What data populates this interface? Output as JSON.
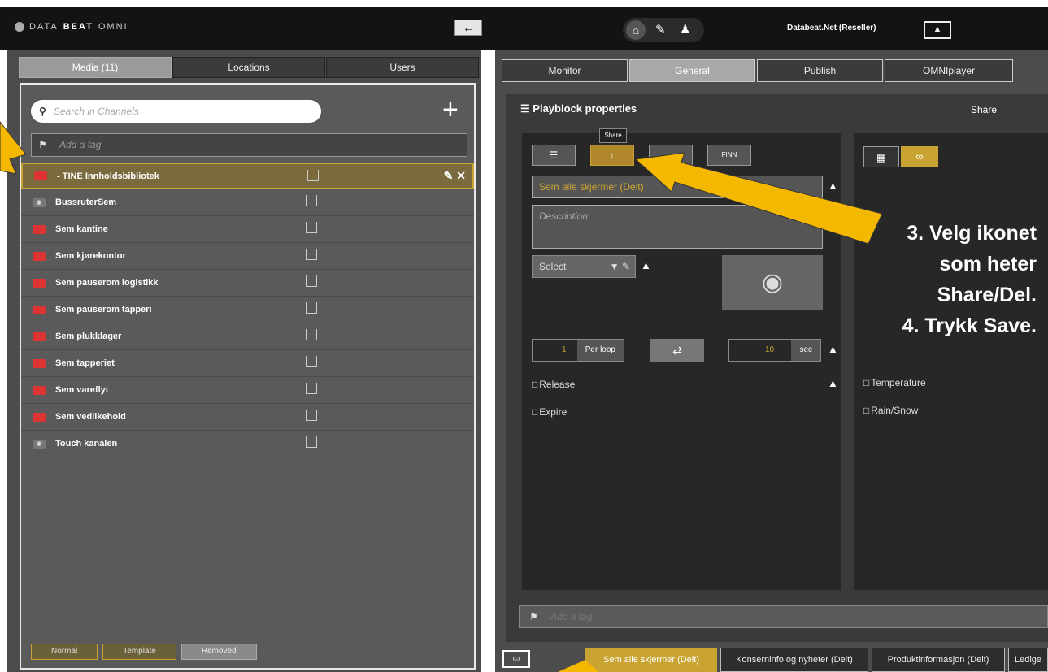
{
  "topbar": {
    "brand_pre": "DATA",
    "brand_bold": "BEAT",
    "brand_post": "OMNI",
    "back_icon": "←",
    "home_icon": "⌂",
    "edit_icon": "✎",
    "user_icon": "♟",
    "reseller": "Databeat.Net (Reseller)",
    "image_icon": "▲"
  },
  "left": {
    "tabs": [
      "Media (11)",
      "Locations",
      "Users"
    ],
    "search_placeholder": "Search in Channels",
    "plus": "+",
    "tag_placeholder": "Add a tag",
    "channels": [
      {
        "name": "- TINE Innholdsbibliotek",
        "icon": "TINE",
        "selected": true
      },
      {
        "name": "BussruterSem",
        "icon": "cam"
      },
      {
        "name": "Sem kantine",
        "icon": "TINE"
      },
      {
        "name": "Sem kjørekontor",
        "icon": "TINE"
      },
      {
        "name": "Sem pauserom logistikk",
        "icon": "TINE"
      },
      {
        "name": "Sem pauserom tapperi",
        "icon": "TINE"
      },
      {
        "name": "Sem plukklager",
        "icon": "TINE"
      },
      {
        "name": "Sem tapperiet",
        "icon": "TINE"
      },
      {
        "name": "Sem vareflyt",
        "icon": "TINE"
      },
      {
        "name": "Sem vedlikehold",
        "icon": "TINE"
      },
      {
        "name": "Touch kanalen",
        "icon": "cam"
      }
    ],
    "row_actions": "✎ ✕",
    "filters": [
      "Normal",
      "Template",
      "Removed"
    ]
  },
  "right": {
    "tabs": [
      "Monitor",
      "General",
      "Publish",
      "OMNIplayer"
    ],
    "props_title": "Playblock properties",
    "props_share": "Share",
    "tooltip": "Share",
    "toolbar": [
      "☰",
      "↑",
      "∞",
      "FINN"
    ],
    "name_value": "Sem alle skjermer (Delt)",
    "desc_placeholder": "Description",
    "select_label": "Select",
    "camera_icon": "◉",
    "loop_count": "1",
    "loop_label": "Per loop",
    "shuffle_icon": "⇄",
    "sec_value": "10",
    "sec_label": "sec",
    "release": "Release",
    "expire": "Expire",
    "calendar_icon": "▦",
    "infinity_icon": "∞",
    "temperature": "Temperature",
    "rain": "Rain/Snow",
    "tag_placeholder": "Add a tag",
    "lock": "▲"
  },
  "bottom_tabs": [
    "Sem alle skjermer (Delt)",
    "Konserninfo og nyheter (Delt)",
    "Produktinformasjon (Delt)",
    "Ledige"
  ],
  "monitor_icon": "▭",
  "annotation": [
    "3. Velg ikonet",
    "som heter",
    "Share/Del.",
    "4. Trykk Save."
  ],
  "colors": {
    "accent": "#c9a432",
    "arrow": "#f5b800",
    "dark": "#272727"
  }
}
